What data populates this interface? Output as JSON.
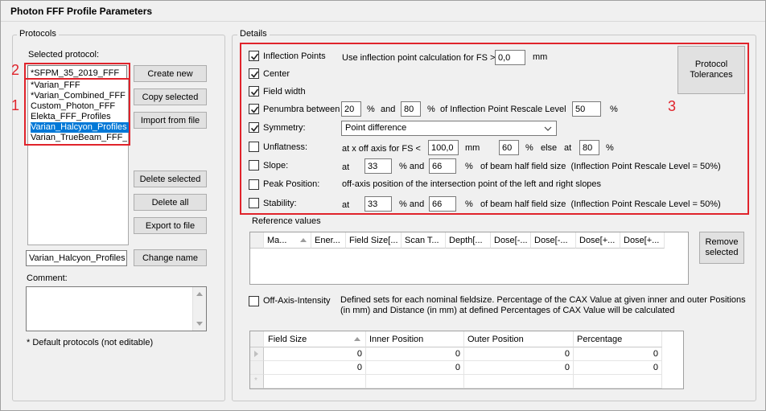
{
  "window": {
    "title": "Photon FFF Profile Parameters"
  },
  "protocols": {
    "legend": "Protocols",
    "selected_label": "Selected protocol:",
    "selected_value": "*SFPM_35_2019_FFF",
    "list_items": [
      "*Varian_FFF",
      "*Varian_Combined_FFF",
      "Custom_Photon_FFF",
      "Elekta_FFF_Profiles",
      "Varian_Halcyon_Profiles",
      "Varian_TrueBeam_FFF_F"
    ],
    "selected_index": 4,
    "buttons": {
      "create_new": "Create new",
      "copy_selected": "Copy selected",
      "import_from_file": "Import from file",
      "delete_selected": "Delete selected",
      "delete_all": "Delete all",
      "export_to_file": "Export to file",
      "change_name": "Change name"
    },
    "name_value": "Varian_Halcyon_Profiles",
    "comment_label": "Comment:",
    "comment_value": "",
    "footnote": "* Default protocols (not editable)"
  },
  "annotations": {
    "n1": "1",
    "n2": "2",
    "n3": "3"
  },
  "details": {
    "legend": "Details",
    "tolerances_button": [
      "Protocol",
      "Tolerances"
    ],
    "inflection": {
      "label": "Inflection Points",
      "checked": true,
      "desc": "Use inflection point calculation for FS >",
      "value": "0,0",
      "unit": "mm"
    },
    "center": {
      "label": "Center",
      "checked": true
    },
    "field_width": {
      "label": "Field width",
      "checked": true
    },
    "penumbra": {
      "label": "Penumbra between",
      "checked": true,
      "v1": "20",
      "pct1": "%",
      "and": "and",
      "v2": "80",
      "pct2": "%",
      "of_text": "of Inflection Point Rescale Level",
      "v3": "50",
      "pct3": "%"
    },
    "symmetry": {
      "label": "Symmetry:",
      "checked": true,
      "selected": "Point difference"
    },
    "unflatness": {
      "label": "Unflatness:",
      "checked": false,
      "desc": "at x off axis for FS <",
      "v1": "100,0",
      "unit": "mm",
      "v2": "60",
      "pct": "%",
      "else": "else",
      "at": "at",
      "v3": "80",
      "pct2": "%"
    },
    "slope": {
      "label": "Slope:",
      "checked": false,
      "at": "at",
      "v1": "33",
      "pct_and": "% and",
      "v2": "66",
      "tail": "%   of beam half field size  (Inflection Point Rescale Level = 50%)"
    },
    "peak": {
      "label": "Peak Position:",
      "checked": false,
      "desc": "off-axis position of the intersection point of the left and right slopes"
    },
    "stability": {
      "label": "Stability:",
      "checked": false,
      "at": "at",
      "v1": "33",
      "pct_and": "% and",
      "v2": "66",
      "tail": "%   of beam half field size  (Inflection Point Rescale Level = 50%)"
    },
    "reference": {
      "label": "Reference values",
      "columns": [
        "Ma...",
        "Ener...",
        "Field Size[...",
        "Scan T...",
        "Depth[...",
        "Dose[-...",
        "Dose[-...",
        "Dose[+...",
        "Dose[+..."
      ],
      "remove_button": [
        "Remove",
        "selected"
      ]
    },
    "off_axis": {
      "label": "Off-Axis-Intensity",
      "checked": false,
      "desc_line1": "Defined sets for each nominal fieldsize. Percentage of the CAX Value at given inner and outer Positions",
      "desc_line2": "(in mm) and Distance (in mm) at defined Percentages of CAX Value will be calculated"
    },
    "oai_table": {
      "columns": [
        "Field Size",
        "Inner Position",
        "Outer Position",
        "Percentage"
      ],
      "rows": [
        [
          "0",
          "0",
          "0",
          "0"
        ],
        [
          "0",
          "0",
          "0",
          "0"
        ]
      ]
    }
  }
}
